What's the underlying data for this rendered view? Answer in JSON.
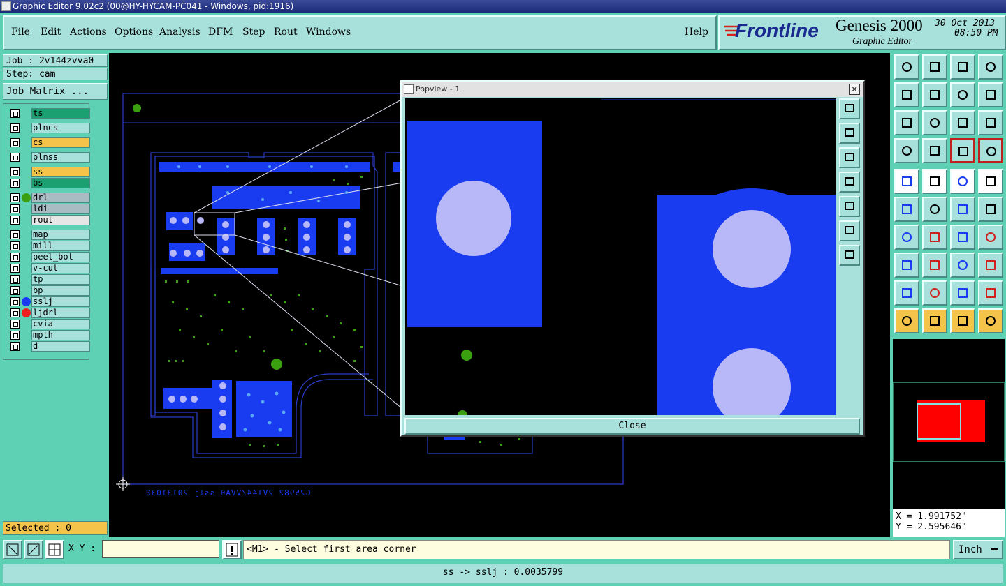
{
  "window": {
    "title": "Graphic Editor 9.02c2 (00@HY-HYCAM-PC041 - Windows, pid:1916)"
  },
  "menu": {
    "items": [
      "File",
      "Edit",
      "Actions",
      "Options",
      "Analysis",
      "DFM",
      "Step",
      "Rout",
      "Windows"
    ],
    "help": "Help"
  },
  "brand": {
    "company": "Frontline",
    "product": "Genesis 2000",
    "subtitle": "Graphic Editor",
    "date": "30 Oct 2013",
    "time": "08:50 PM"
  },
  "job": {
    "label": "Job : 2v144zvva0",
    "step": "Step: cam",
    "matrix_button": "Job Matrix ..."
  },
  "layers": [
    {
      "name": "ts",
      "color": "#1aa071",
      "dot": ""
    },
    {
      "name": "plncs",
      "color": "#a8e0dc",
      "dot": ""
    },
    {
      "name": "cs",
      "color": "#f4c44a",
      "dot": ""
    },
    {
      "name": "plnss",
      "color": "#a8e0dc",
      "dot": ""
    },
    {
      "name": "ss",
      "color": "#f4c44a",
      "dot": ""
    },
    {
      "name": "bs",
      "color": "#1aa071",
      "dot": ""
    },
    {
      "name": "drl",
      "color": "#a9bcc4",
      "dot": "#3aa010"
    },
    {
      "name": "ldi",
      "color": "#a9bcc4",
      "dot": ""
    },
    {
      "name": "rout",
      "color": "#e6e6e6",
      "dot": ""
    },
    {
      "name": "map",
      "color": "#a8e0dc",
      "dot": ""
    },
    {
      "name": "mill",
      "color": "#a8e0dc",
      "dot": ""
    },
    {
      "name": "peel_bot",
      "color": "#a8e0dc",
      "dot": ""
    },
    {
      "name": "v-cut",
      "color": "#a8e0dc",
      "dot": ""
    },
    {
      "name": "tp",
      "color": "#a8e0dc",
      "dot": ""
    },
    {
      "name": "bp",
      "color": "#a8e0dc",
      "dot": ""
    },
    {
      "name": "sslj",
      "color": "#a8e0dc",
      "dot": "#1a3cf0"
    },
    {
      "name": "ljdrl",
      "color": "#a8e0dc",
      "dot": "#ee2020"
    },
    {
      "name": "cvia",
      "color": "#a8e0dc",
      "dot": ""
    },
    {
      "name": "mpth",
      "color": "#a8e0dc",
      "dot": ""
    },
    {
      "name": "d",
      "color": "#a8e0dc",
      "dot": ""
    }
  ],
  "canvas": {
    "mirrored_text": "G25982 2V144ZVVA0 sslj 20131030"
  },
  "popview": {
    "title": "Popview - 1",
    "close_label": "Close"
  },
  "coords": {
    "x": "X = 1.991752\"",
    "y": "Y = 2.595646\""
  },
  "selected": "Selected : 0",
  "xy_label": "X Y :",
  "xy_value": "",
  "prompt": "<M1> - Select first area corner",
  "units": "Inch",
  "status": "ss -> sslj : 0.0035799",
  "colors": {
    "panel": "#5ed1b5",
    "button": "#a8e0dc",
    "pad": "#1a3cf0",
    "drill": "#b8b8f8",
    "via": "#3aa010"
  }
}
